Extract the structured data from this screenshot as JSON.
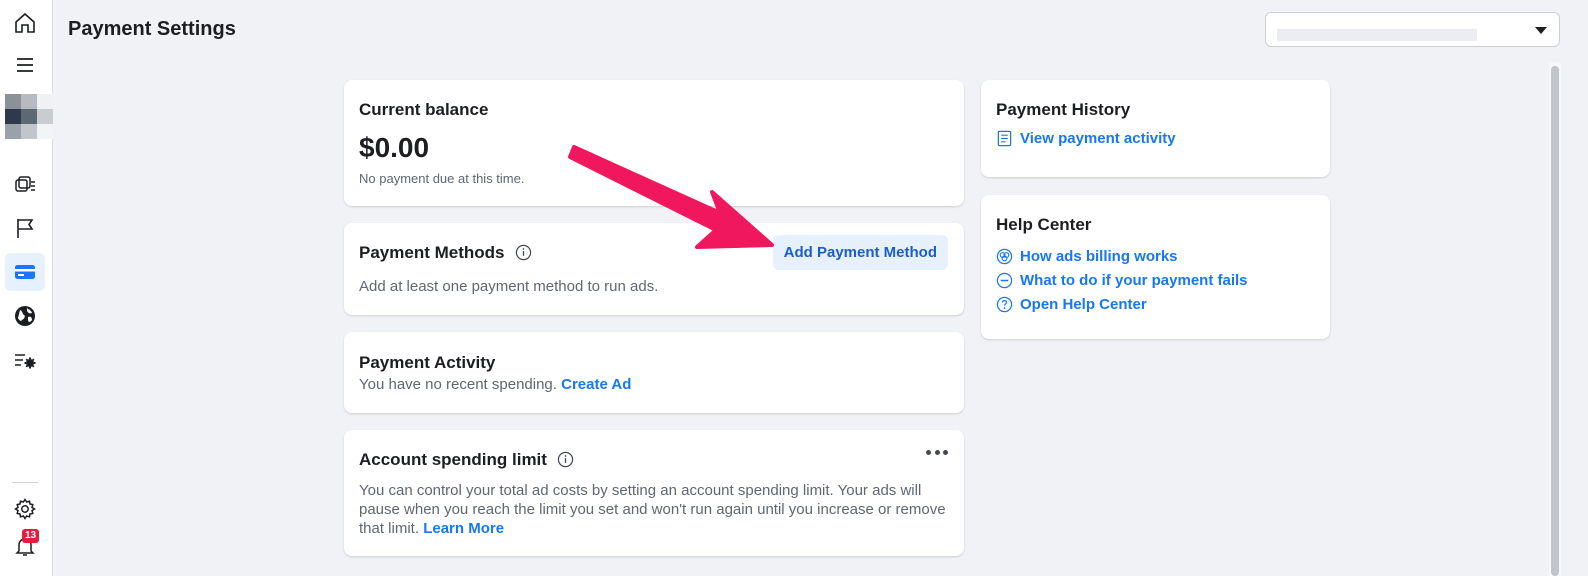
{
  "header": {
    "title": "Payment Settings"
  },
  "sidebar": {
    "notification_count": "13"
  },
  "balance": {
    "title": "Current balance",
    "amount": "$0.00",
    "note": "No payment due at this time."
  },
  "payment_methods": {
    "title": "Payment Methods",
    "button": "Add Payment Method",
    "note": "Add at least one payment method to run ads."
  },
  "payment_activity": {
    "title": "Payment Activity",
    "text": "You have no recent spending.",
    "link": "Create Ad"
  },
  "spending_limit": {
    "title": "Account spending limit",
    "text": "You can control your total ad costs by setting an account spending limit. Your ads will pause when you reach the limit you set and won't run again until you increase or remove that limit.",
    "link": "Learn More"
  },
  "payment_history": {
    "title": "Payment History",
    "link": "View payment activity"
  },
  "help_center": {
    "title": "Help Center",
    "links": [
      "How ads billing works",
      "What to do if your payment fails",
      "Open Help Center"
    ]
  },
  "colors": {
    "accent": "#1877f2",
    "arrow": "#f0175f",
    "badge": "#e41e3f"
  }
}
